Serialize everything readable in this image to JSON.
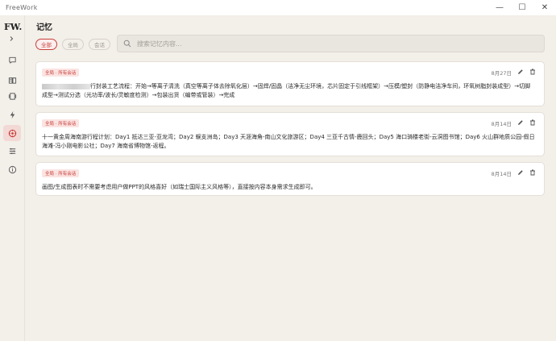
{
  "window": {
    "title": "FreeWork",
    "minimize": "—",
    "maximize": "☐",
    "close": "✕"
  },
  "sidebar": {
    "logo": "FW.",
    "expand_icon": "chevron-right-icon",
    "items": [
      {
        "name": "chat",
        "icon": "message-icon"
      },
      {
        "name": "library",
        "icon": "book-icon"
      },
      {
        "name": "media",
        "icon": "film-icon"
      },
      {
        "name": "skills",
        "icon": "lightning-icon"
      },
      {
        "name": "memory",
        "icon": "memory-icon",
        "active": true
      },
      {
        "name": "settings",
        "icon": "sliders-icon"
      },
      {
        "name": "about",
        "icon": "info-icon"
      }
    ]
  },
  "page": {
    "title": "记忆",
    "filters": [
      {
        "label": "全部",
        "active": true
      },
      {
        "label": "全局",
        "active": false
      },
      {
        "label": "会话",
        "active": false
      }
    ],
    "search": {
      "placeholder": "搜索记忆内容..."
    }
  },
  "memories": [
    {
      "tag": "全局 · 所有会话",
      "date": "8月27日",
      "content": "行封装工艺流程：开始→等离子清洗（真空等离子体去除氧化层）→固焊/固晶（洁净无尘环境，芯片固定于引线框架）→压模/塑封（防静电洁净车间，环氧树脂封装成型）→切脚成型→测试分选（光功率/波长/灵敏度检测）→包装出货（编带或管装）→完成"
    },
    {
      "tag": "全局 · 所有会话",
      "date": "8月14日",
      "content": "十一黄金周海南游行程计划：Day1 抵达三亚-亚龙湾；Day2 蜈支洲岛；Day3 天涯海角-南山文化旅游区；Day4 三亚千古情-鹿回头；Day5 海口骑楼老街-云洞图书馆；Day6 火山群地质公园-假日海滩-冯小刚电影公社；Day7 海南省博物馆-返程。"
    },
    {
      "tag": "全局 · 所有会话",
      "date": "8月14日",
      "content": "画图/生成图表时不需要考虑用户做PPT的风格喜好（如瑞士国际主义风格等），直接按内容本身需求生成即可。"
    }
  ],
  "colors": {
    "accent": "#c8403c",
    "background": "#f3efe9",
    "card": "#ffffff",
    "tag_bg": "#fbe4e2"
  }
}
